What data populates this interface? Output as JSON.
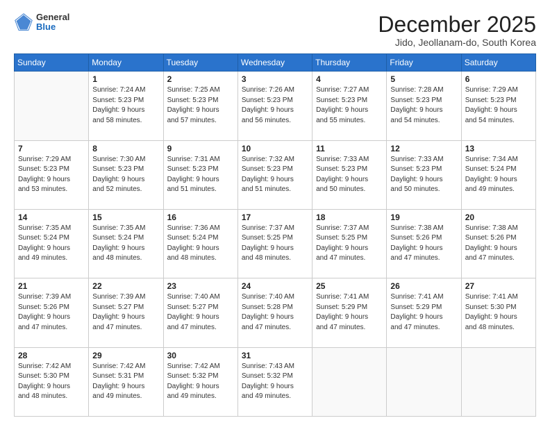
{
  "logo": {
    "general": "General",
    "blue": "Blue"
  },
  "header": {
    "month": "December 2025",
    "location": "Jido, Jeollanam-do, South Korea"
  },
  "days_of_week": [
    "Sunday",
    "Monday",
    "Tuesday",
    "Wednesday",
    "Thursday",
    "Friday",
    "Saturday"
  ],
  "weeks": [
    [
      {
        "day": "",
        "info": ""
      },
      {
        "day": "1",
        "info": "Sunrise: 7:24 AM\nSunset: 5:23 PM\nDaylight: 9 hours\nand 58 minutes."
      },
      {
        "day": "2",
        "info": "Sunrise: 7:25 AM\nSunset: 5:23 PM\nDaylight: 9 hours\nand 57 minutes."
      },
      {
        "day": "3",
        "info": "Sunrise: 7:26 AM\nSunset: 5:23 PM\nDaylight: 9 hours\nand 56 minutes."
      },
      {
        "day": "4",
        "info": "Sunrise: 7:27 AM\nSunset: 5:23 PM\nDaylight: 9 hours\nand 55 minutes."
      },
      {
        "day": "5",
        "info": "Sunrise: 7:28 AM\nSunset: 5:23 PM\nDaylight: 9 hours\nand 54 minutes."
      },
      {
        "day": "6",
        "info": "Sunrise: 7:29 AM\nSunset: 5:23 PM\nDaylight: 9 hours\nand 54 minutes."
      }
    ],
    [
      {
        "day": "7",
        "info": "Sunrise: 7:29 AM\nSunset: 5:23 PM\nDaylight: 9 hours\nand 53 minutes."
      },
      {
        "day": "8",
        "info": "Sunrise: 7:30 AM\nSunset: 5:23 PM\nDaylight: 9 hours\nand 52 minutes."
      },
      {
        "day": "9",
        "info": "Sunrise: 7:31 AM\nSunset: 5:23 PM\nDaylight: 9 hours\nand 51 minutes."
      },
      {
        "day": "10",
        "info": "Sunrise: 7:32 AM\nSunset: 5:23 PM\nDaylight: 9 hours\nand 51 minutes."
      },
      {
        "day": "11",
        "info": "Sunrise: 7:33 AM\nSunset: 5:23 PM\nDaylight: 9 hours\nand 50 minutes."
      },
      {
        "day": "12",
        "info": "Sunrise: 7:33 AM\nSunset: 5:23 PM\nDaylight: 9 hours\nand 50 minutes."
      },
      {
        "day": "13",
        "info": "Sunrise: 7:34 AM\nSunset: 5:24 PM\nDaylight: 9 hours\nand 49 minutes."
      }
    ],
    [
      {
        "day": "14",
        "info": "Sunrise: 7:35 AM\nSunset: 5:24 PM\nDaylight: 9 hours\nand 49 minutes."
      },
      {
        "day": "15",
        "info": "Sunrise: 7:35 AM\nSunset: 5:24 PM\nDaylight: 9 hours\nand 48 minutes."
      },
      {
        "day": "16",
        "info": "Sunrise: 7:36 AM\nSunset: 5:24 PM\nDaylight: 9 hours\nand 48 minutes."
      },
      {
        "day": "17",
        "info": "Sunrise: 7:37 AM\nSunset: 5:25 PM\nDaylight: 9 hours\nand 48 minutes."
      },
      {
        "day": "18",
        "info": "Sunrise: 7:37 AM\nSunset: 5:25 PM\nDaylight: 9 hours\nand 47 minutes."
      },
      {
        "day": "19",
        "info": "Sunrise: 7:38 AM\nSunset: 5:26 PM\nDaylight: 9 hours\nand 47 minutes."
      },
      {
        "day": "20",
        "info": "Sunrise: 7:38 AM\nSunset: 5:26 PM\nDaylight: 9 hours\nand 47 minutes."
      }
    ],
    [
      {
        "day": "21",
        "info": "Sunrise: 7:39 AM\nSunset: 5:26 PM\nDaylight: 9 hours\nand 47 minutes."
      },
      {
        "day": "22",
        "info": "Sunrise: 7:39 AM\nSunset: 5:27 PM\nDaylight: 9 hours\nand 47 minutes."
      },
      {
        "day": "23",
        "info": "Sunrise: 7:40 AM\nSunset: 5:27 PM\nDaylight: 9 hours\nand 47 minutes."
      },
      {
        "day": "24",
        "info": "Sunrise: 7:40 AM\nSunset: 5:28 PM\nDaylight: 9 hours\nand 47 minutes."
      },
      {
        "day": "25",
        "info": "Sunrise: 7:41 AM\nSunset: 5:29 PM\nDaylight: 9 hours\nand 47 minutes."
      },
      {
        "day": "26",
        "info": "Sunrise: 7:41 AM\nSunset: 5:29 PM\nDaylight: 9 hours\nand 47 minutes."
      },
      {
        "day": "27",
        "info": "Sunrise: 7:41 AM\nSunset: 5:30 PM\nDaylight: 9 hours\nand 48 minutes."
      }
    ],
    [
      {
        "day": "28",
        "info": "Sunrise: 7:42 AM\nSunset: 5:30 PM\nDaylight: 9 hours\nand 48 minutes."
      },
      {
        "day": "29",
        "info": "Sunrise: 7:42 AM\nSunset: 5:31 PM\nDaylight: 9 hours\nand 49 minutes."
      },
      {
        "day": "30",
        "info": "Sunrise: 7:42 AM\nSunset: 5:32 PM\nDaylight: 9 hours\nand 49 minutes."
      },
      {
        "day": "31",
        "info": "Sunrise: 7:43 AM\nSunset: 5:32 PM\nDaylight: 9 hours\nand 49 minutes."
      },
      {
        "day": "",
        "info": ""
      },
      {
        "day": "",
        "info": ""
      },
      {
        "day": "",
        "info": ""
      }
    ]
  ]
}
